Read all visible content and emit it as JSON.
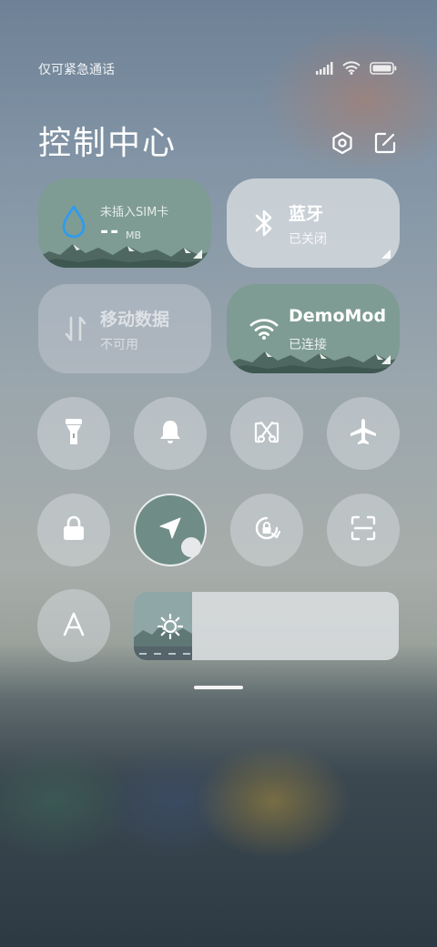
{
  "status_bar": {
    "carrier_text": "仅可紧急通话",
    "icons": [
      "signal-icon",
      "wifi-icon",
      "battery-icon"
    ]
  },
  "header": {
    "title": "控制中心",
    "buttons": [
      "settings-icon",
      "edit-icon"
    ]
  },
  "tiles": {
    "data_usage": {
      "icon": "water-drop-icon",
      "label": "未插入SIM卡",
      "value": "--",
      "unit": "MB",
      "state": "active"
    },
    "bluetooth": {
      "icon": "bluetooth-icon",
      "title": "蓝牙",
      "status": "已关闭",
      "state": "off"
    },
    "mobile_data": {
      "icon": "mobile-data-icon",
      "title": "移动数据",
      "status": "不可用",
      "state": "disabled"
    },
    "wifi": {
      "icon": "wifi-icon",
      "title": "DemoMod",
      "status": "已连接",
      "state": "on"
    }
  },
  "toggles": [
    {
      "name": "flashlight",
      "icon": "flashlight-icon",
      "active": false
    },
    {
      "name": "mute",
      "icon": "bell-icon",
      "active": false
    },
    {
      "name": "screenshot",
      "icon": "scissors-icon",
      "active": false
    },
    {
      "name": "airplane-mode",
      "icon": "airplane-icon",
      "active": false
    },
    {
      "name": "screen-lock",
      "icon": "lock-icon",
      "active": false
    },
    {
      "name": "location",
      "icon": "location-arrow-icon",
      "active": true
    },
    {
      "name": "auto-rotate",
      "icon": "rotation-lock-icon",
      "active": false
    },
    {
      "name": "scanner",
      "icon": "scan-icon",
      "active": false
    },
    {
      "name": "font-size",
      "icon": "font-a-icon",
      "active": false
    }
  ],
  "brightness": {
    "icon": "sun-icon",
    "level_fraction": 0.22
  },
  "colors": {
    "accent_green": "#7e9c93",
    "bluetooth_off_tile": "#e1e4e8",
    "data_drop_blue": "#2e9bf0"
  }
}
